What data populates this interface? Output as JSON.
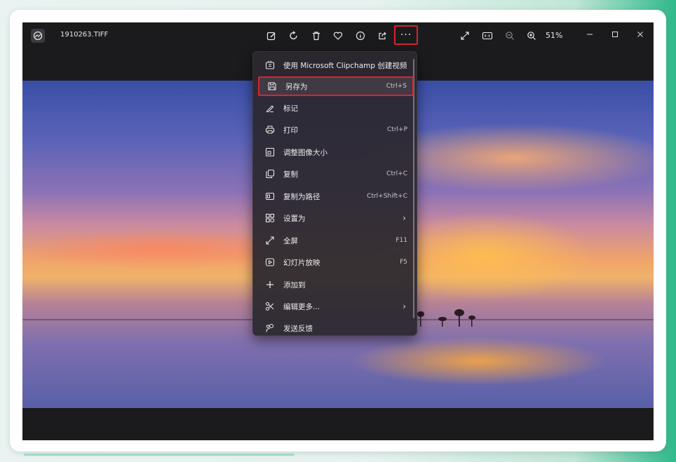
{
  "window": {
    "file_name": "1910263.TIFF",
    "zoom_percent": "51%"
  },
  "toolbar": {
    "more_label": "···",
    "icons": [
      "edit-image-icon",
      "rotate-icon",
      "delete-icon",
      "favorite-icon",
      "info-icon",
      "share-icon",
      "more-icon"
    ],
    "right_icons": [
      "fullscreen-icon",
      "actual-size-icon",
      "zoom-out-icon",
      "zoom-in-icon"
    ]
  },
  "menu": {
    "items": [
      {
        "label": "使用 Microsoft Clipchamp 创建视频",
        "shortcut": "",
        "icon": "clipchamp-icon",
        "submenu": false
      },
      {
        "label": "另存为",
        "shortcut": "Ctrl+S",
        "icon": "save-icon",
        "submenu": false
      },
      {
        "label": "标记",
        "shortcut": "",
        "icon": "markup-icon",
        "submenu": false
      },
      {
        "label": "打印",
        "shortcut": "Ctrl+P",
        "icon": "print-icon",
        "submenu": false
      },
      {
        "label": "调整图像大小",
        "shortcut": "",
        "icon": "resize-icon",
        "submenu": false
      },
      {
        "label": "复制",
        "shortcut": "Ctrl+C",
        "icon": "copy-icon",
        "submenu": false
      },
      {
        "label": "复制为路径",
        "shortcut": "Ctrl+Shift+C",
        "icon": "copy-path-icon",
        "submenu": false
      },
      {
        "label": "设置为",
        "shortcut": "",
        "icon": "set-as-icon",
        "submenu": true
      },
      {
        "label": "全屏",
        "shortcut": "F11",
        "icon": "fullscreen-icon",
        "submenu": false
      },
      {
        "label": "幻灯片放映",
        "shortcut": "F5",
        "icon": "slideshow-icon",
        "submenu": false
      },
      {
        "label": "添加到",
        "shortcut": "",
        "icon": "add-icon",
        "submenu": false
      },
      {
        "label": "编辑更多...",
        "shortcut": "",
        "icon": "edit-more-icon",
        "submenu": true
      },
      {
        "label": "发送反馈",
        "shortcut": "",
        "icon": "feedback-icon",
        "submenu": false
      }
    ],
    "chevron": "›"
  },
  "colors": {
    "highlight_border": "#d8242e",
    "app_background": "#1b1b1d",
    "menu_background": "#2c2830"
  }
}
